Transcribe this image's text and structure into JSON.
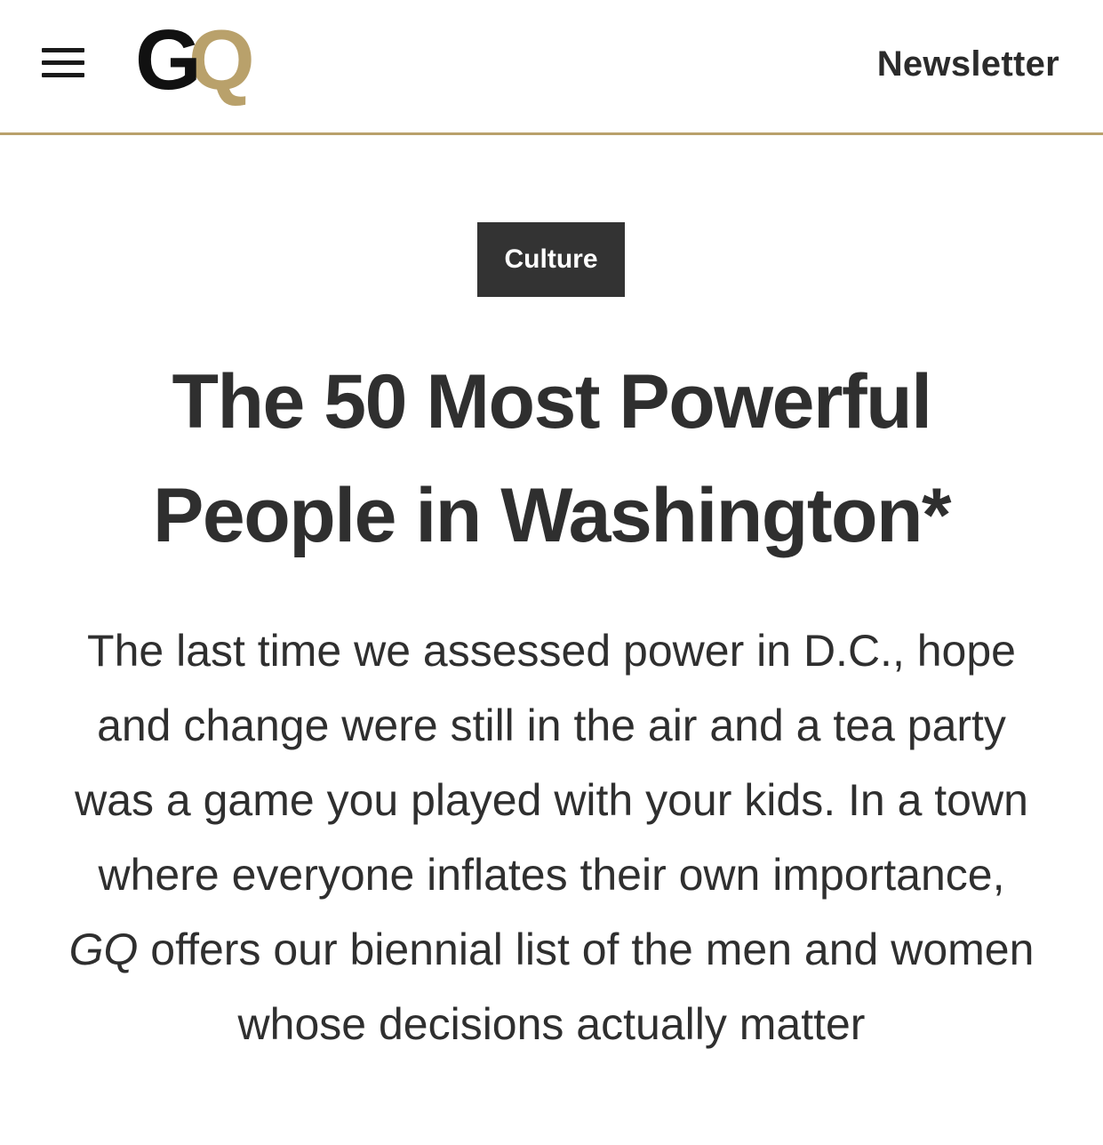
{
  "header": {
    "menu_icon": "hamburger-menu-icon",
    "logo": {
      "text": "GQ",
      "letters": [
        "G",
        "Q"
      ],
      "colors": {
        "g": "#111111",
        "q": "#b9a16b"
      }
    },
    "newsletter_label": "Newsletter",
    "divider_color": "#b9a16b"
  },
  "article": {
    "category": "Culture",
    "headline_line1": "The 50 Most Powerful",
    "headline_line2": "People in Washington*",
    "dek": {
      "before": "The last time we assessed power in D.C., hope and change were still in the air and a tea party was a game you played with your kids. In a town where everyone inflates their own importance, ",
      "publication": "GQ",
      "after": " offers our biennial list of the men and women whose decisions actually matter"
    }
  },
  "colors": {
    "text": "#2f2f2f",
    "badge_bg": "#333333",
    "badge_text": "#ffffff",
    "accent_gold": "#b9a16b"
  }
}
